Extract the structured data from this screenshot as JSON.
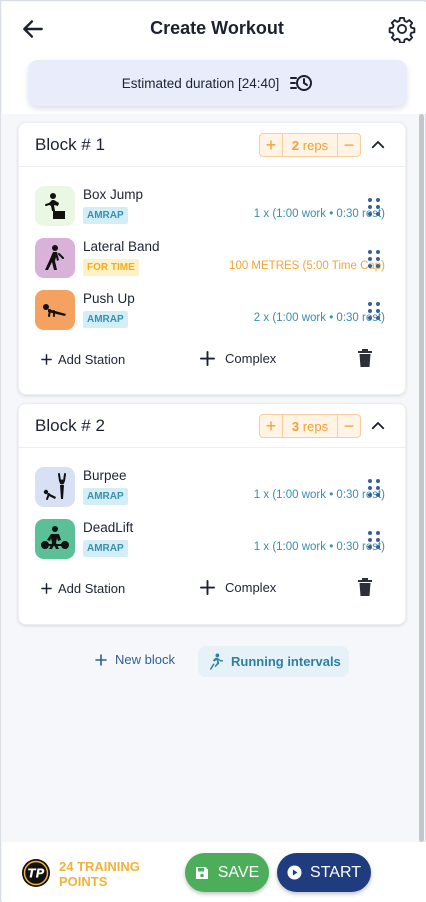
{
  "header": {
    "title": "Create Workout",
    "back_icon": "arrow-left-icon",
    "settings_icon": "gear-icon"
  },
  "duration": {
    "label": "Estimated duration [24:40]",
    "icon": "timer-list-icon"
  },
  "blocks": [
    {
      "title": "Block # 1",
      "reps_value": "2",
      "reps_unit": "reps",
      "plus": "+",
      "minus": "−",
      "exercises": [
        {
          "name": "Box Jump",
          "badge": "AMRAP",
          "detail": "1 x (1:00 work • 0:30 rest)",
          "icon": "box-jump-icon"
        },
        {
          "name": "Lateral Band",
          "badge": "FOR TIME",
          "detail": "100 METRES (5:00 Time Cap)",
          "icon": "lateral-band-icon"
        },
        {
          "name": "Push Up",
          "badge": "AMRAP",
          "detail": "2 x (1:00 work • 0:30 rest)",
          "icon": "push-up-icon"
        }
      ],
      "add_station": "Add Station",
      "complex": "Complex"
    },
    {
      "title": "Block # 2",
      "reps_value": "3",
      "reps_unit": "reps",
      "plus": "+",
      "minus": "−",
      "exercises": [
        {
          "name": "Burpee",
          "badge": "AMRAP",
          "detail": "1 x (1:00 work • 0:30 rest)",
          "icon": "burpee-icon"
        },
        {
          "name": "DeadLift",
          "badge": "AMRAP",
          "detail": "1 x (1:00 work • 0:30 rest)",
          "icon": "deadlift-icon"
        }
      ],
      "add_station": "Add Station",
      "complex": "Complex"
    }
  ],
  "actions": {
    "new_block": "New block",
    "running_intervals": "Running intervals"
  },
  "footer": {
    "points_line1": "24 TRAINING",
    "points_line2": "POINTS",
    "logo_text": "TP",
    "save": "SAVE",
    "start": "START"
  },
  "colors": {
    "accent_orange": "#f0a035",
    "amrap_blue": "#3690b4",
    "save_green": "#4cae5b",
    "start_navy": "#1f3c7e"
  }
}
